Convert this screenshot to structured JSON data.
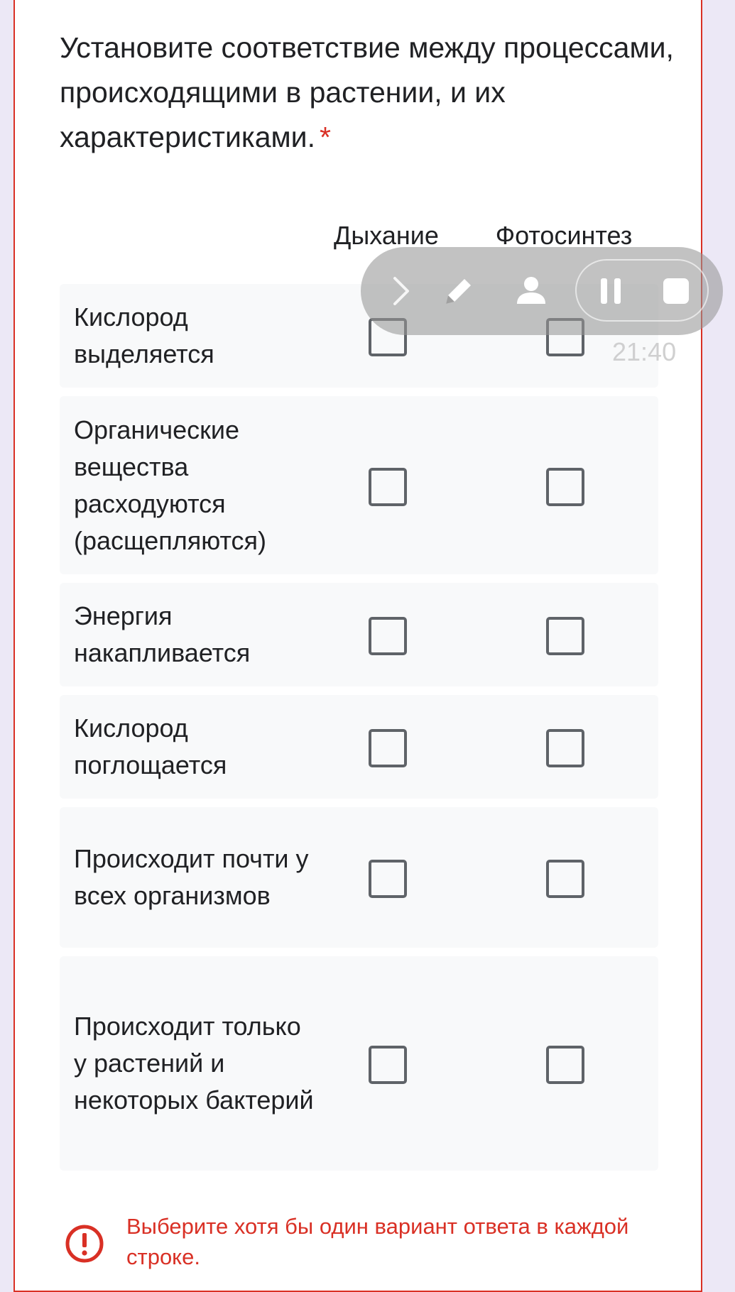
{
  "question": {
    "title": "Установите соответствие между процессами, происходящими в растении, и их характеристиками.",
    "required_marker": "*"
  },
  "columns": [
    "Дыхание",
    "Фотосинтез"
  ],
  "rows": [
    {
      "label": "Кислород выделяется",
      "dyhanie_checked": false,
      "fotosintez_checked": false
    },
    {
      "label": "Органические вещества расходуются (расщепляются)",
      "dyhanie_checked": false,
      "fotosintez_checked": false
    },
    {
      "label": "Энергия накапливается",
      "dyhanie_checked": false,
      "fotosintez_checked": false
    },
    {
      "label": "Кислород поглощается",
      "dyhanie_checked": false,
      "fotosintez_checked": false
    },
    {
      "label": "Происходит почти у всех организмов",
      "dyhanie_checked": false,
      "fotosintez_checked": false
    },
    {
      "label": "Происходит только у растений и некоторых бактерий",
      "dyhanie_checked": false,
      "fotosintez_checked": false
    }
  ],
  "error": {
    "icon": "error-exclamation-icon",
    "message": "Выберите хотя бы один вариант ответа в каждой строке."
  },
  "overlay": {
    "time": "21:40",
    "icons": [
      "chevron-right-icon",
      "pencil-icon",
      "user-icon",
      "pause-icon",
      "stop-icon"
    ]
  },
  "colors": {
    "error_red": "#d93025",
    "row_background": "#f8f9fa",
    "checkbox_border": "#5f6368",
    "page_background": "#ece8f6"
  }
}
